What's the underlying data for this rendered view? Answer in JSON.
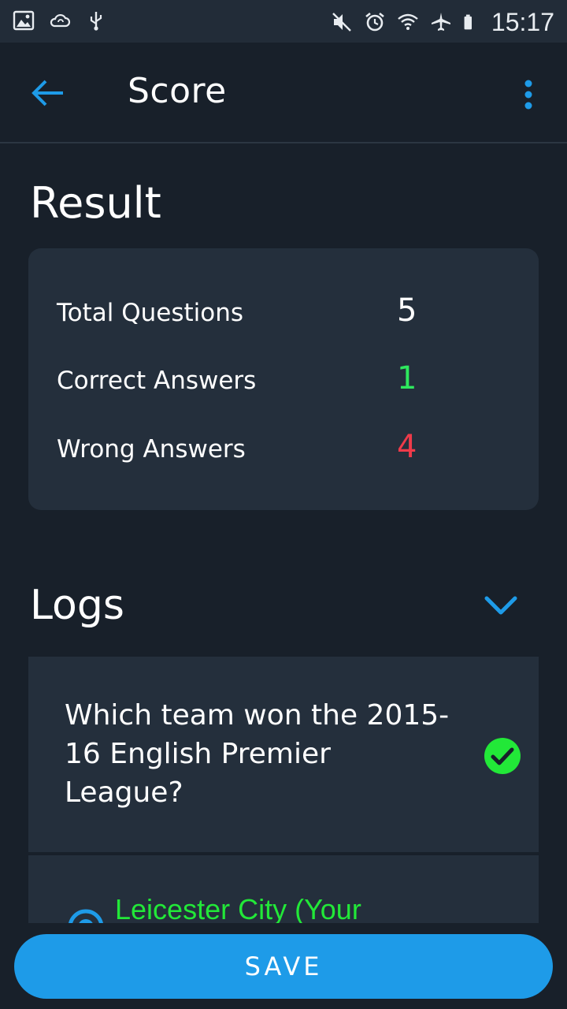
{
  "status_bar": {
    "time": "15:17",
    "left_icons": [
      "image-icon",
      "cloud-sync-icon",
      "usb-icon"
    ],
    "right_icons": [
      "mute-icon",
      "alarm-icon",
      "wifi-icon",
      "airplane-icon",
      "battery-icon"
    ]
  },
  "app_bar": {
    "title": "Score",
    "back_icon": "arrow-left-icon",
    "menu_icon": "more-vert-icon"
  },
  "result": {
    "title": "Result",
    "rows": [
      {
        "label": "Total Questions",
        "value": "5"
      },
      {
        "label": "Correct Answers",
        "value": "1"
      },
      {
        "label": "Wrong Answers",
        "value": "4"
      }
    ]
  },
  "logs": {
    "title": "Logs",
    "toggle_icon": "chevron-down-icon",
    "items": [
      {
        "question": "Which team won the 2015-16 English Premier League?",
        "status_icon": "check-circle-icon",
        "answer": "Leicester City (Your"
      }
    ]
  },
  "save_label": "SAVE",
  "colors": {
    "background": "#18202a",
    "card": "#242f3c",
    "accent": "#1e9be8",
    "correct": "#2ee85e",
    "wrong": "#ef3b4a"
  }
}
